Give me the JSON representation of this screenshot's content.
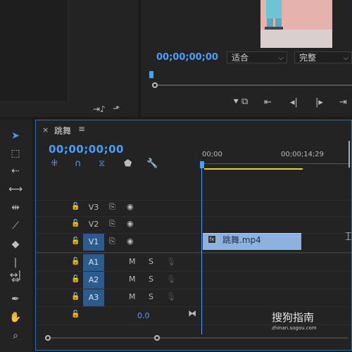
{
  "program": {
    "timecode": "00;00;00;00",
    "fit_label": "适合",
    "quality_label": "完整"
  },
  "timeline": {
    "tab_title": "跳舞",
    "close_label": "×",
    "menu_label": "≡",
    "timecode": "00;00;00;00",
    "ruler": [
      "00;00",
      "00;00;14;29"
    ],
    "tracks": [
      {
        "name": "V3",
        "type": "video",
        "selected": false
      },
      {
        "name": "V2",
        "type": "video",
        "selected": false
      },
      {
        "name": "V1",
        "type": "video",
        "selected": true
      },
      {
        "name": "A1",
        "type": "audio",
        "selected": true
      },
      {
        "name": "A2",
        "type": "audio",
        "selected": true
      },
      {
        "name": "A3",
        "type": "audio",
        "selected": true
      }
    ],
    "audio_mute": "M",
    "audio_solo": "S",
    "master_level": "0.0",
    "clip": {
      "label": "跳舞.mp4",
      "badge": "fx"
    }
  },
  "watermark": {
    "text": "搜狗指南",
    "sub": "zhinan.sogou.com"
  },
  "colors": {
    "accent": "#4a9eff",
    "clip": "#8db2e0",
    "track_selected": "#2c5c8e",
    "ruler_work_area": "#e8d12a"
  },
  "tools": [
    "selection-tool",
    "track-select-tool",
    "ripple-edit-tool",
    "rolling-edit-tool",
    "rate-stretch-tool",
    "razor-tool",
    "slip-tool",
    "slide-tool",
    "pen-tool",
    "hand-tool",
    "zoom-tool"
  ]
}
